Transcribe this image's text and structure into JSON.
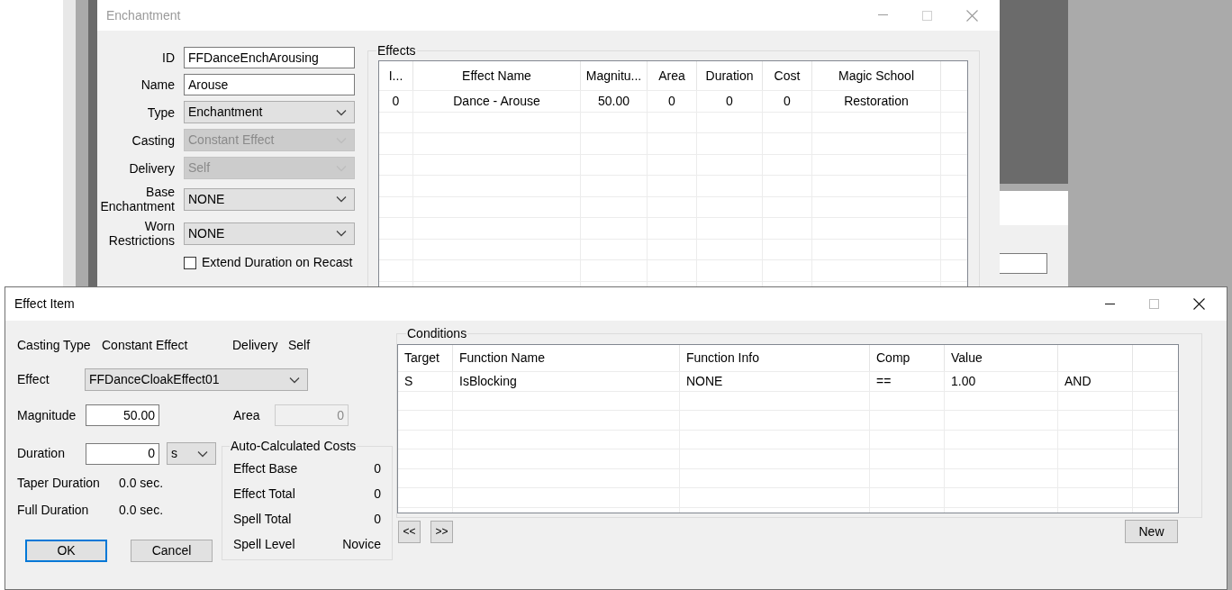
{
  "enchantment_window": {
    "title": "Enchantment",
    "active": false,
    "fields": [
      {
        "label": "ID",
        "kind": "text",
        "value": "FFDanceEnchArousing",
        "disabled": false
      },
      {
        "label": "Name",
        "kind": "text",
        "value": "Arouse",
        "disabled": false
      },
      {
        "label": "Type",
        "kind": "select",
        "value": "Enchantment",
        "disabled": false
      },
      {
        "label": "Casting",
        "kind": "select",
        "value": "Constant Effect",
        "disabled": true
      },
      {
        "label": "Delivery",
        "kind": "select",
        "value": "Self",
        "disabled": true
      },
      {
        "label": "Base Enchantment",
        "kind": "select",
        "value": "NONE",
        "disabled": false
      },
      {
        "label": "Worn Restrictions",
        "kind": "select",
        "value": "NONE",
        "disabled": false
      }
    ],
    "checkbox": {
      "label": "Extend Duration on Recast",
      "checked": false
    },
    "effects": {
      "title": "Effects",
      "columns": [
        "I...",
        "Effect Name",
        "Magnitu...",
        "Area",
        "Duration",
        "Cost",
        "Magic School"
      ],
      "rows": [
        [
          "0",
          "Dance - Arouse",
          "50.00",
          "0",
          "0",
          "0",
          "Restoration"
        ]
      ]
    }
  },
  "effect_item_window": {
    "title": "Effect Item",
    "active": true,
    "casting_type": {
      "label": "Casting Type",
      "value": "Constant Effect"
    },
    "delivery": {
      "label": "Delivery",
      "value": "Self"
    },
    "effect": {
      "label": "Effect",
      "value": "FFDanceCloakEffect01"
    },
    "magnitude": {
      "label": "Magnitude",
      "value": "50.00"
    },
    "area": {
      "label": "Area",
      "value": "0",
      "disabled": true
    },
    "duration": {
      "label": "Duration",
      "value": "0",
      "unit": "s"
    },
    "taper_duration": {
      "label": "Taper Duration",
      "value": "0.0 sec."
    },
    "full_duration": {
      "label": "Full Duration",
      "value": "0.0 sec."
    },
    "costs": {
      "title": "Auto-Calculated Costs",
      "rows": [
        {
          "label": "Effect Base",
          "value": "0"
        },
        {
          "label": "Effect Total",
          "value": "0"
        },
        {
          "label": "Spell Total",
          "value": "0"
        },
        {
          "label": "Spell Level",
          "value": "Novice"
        }
      ]
    },
    "buttons": [
      {
        "label": "OK",
        "default": true
      },
      {
        "label": "Cancel",
        "default": false
      }
    ],
    "conditions": {
      "title": "Conditions",
      "columns": [
        "Target",
        "Function Name",
        "Function Info",
        "Comp",
        "Value"
      ],
      "rows": [
        [
          "S",
          "IsBlocking",
          "NONE",
          "==",
          "1.00",
          "AND"
        ]
      ],
      "buttons": [
        "<<",
        ">>"
      ],
      "new_button": "New"
    }
  }
}
